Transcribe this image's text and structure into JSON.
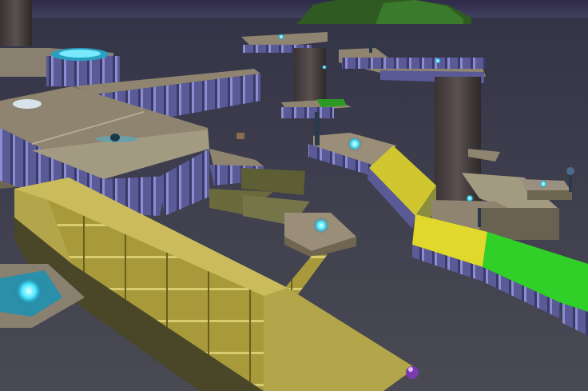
{
  "scene": {
    "colors": {
      "sky": "#3c3658",
      "water": "#3f3f4b",
      "island": "#2f6a2a",
      "stone_top": "#8e8470",
      "stone_side": "#5a5a96",
      "wall_stripe": "#8c8cd0",
      "yellow_block": "#c8c030",
      "gold_walkway": "#b3a64a",
      "green_pad": "#39d82a",
      "olive_pad": "#6a6a3c",
      "pillar": "#4a4040",
      "crystal": "#43e6ff"
    },
    "objects": [
      "stone-platform",
      "gold-walkway",
      "yellow-ramp",
      "green-goal-pad",
      "olive-pressure-plates",
      "crystal-pickups",
      "stone-pillars",
      "distant-island"
    ]
  }
}
